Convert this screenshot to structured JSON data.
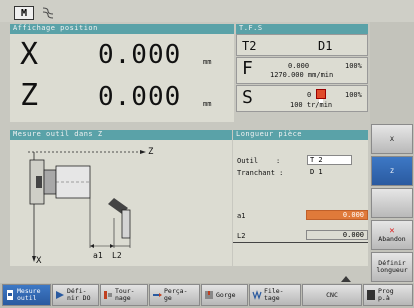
{
  "top_icons": [
    {
      "name": "m-icon",
      "label": "M"
    },
    {
      "name": "spiral-icon",
      "label": ""
    }
  ],
  "position": {
    "title": "Affichage position",
    "x_axis": "X",
    "x_value": "0.000",
    "z_axis": "Z",
    "z_value": "0.000",
    "unit": "mm"
  },
  "tfs": {
    "title": "T.F.S",
    "t_label": "T2",
    "d_label": "D1",
    "f_letter": "F",
    "f_value": "0.000",
    "f_percent": "100%",
    "f_feed": "1270.000 mm/min",
    "s_letter": "S",
    "s_value": "0",
    "s_percent": "100%",
    "s_speed": "100 tr/min"
  },
  "measure": {
    "title": "Mesure outil dans Z",
    "axis_z": "Z",
    "axis_x": "X",
    "dim_a1": "a1",
    "dim_l2": "L2"
  },
  "length": {
    "title": "Longueur pièce",
    "outil_label": "Outil",
    "outil_colon": ":",
    "outil_value": "T 2",
    "tranchant_label": "Tranchant :",
    "tranchant_value": "D 1",
    "a1_label": "a1",
    "a1_value": "0.000",
    "l2_label": "L2",
    "l2_value": "0.000"
  },
  "right_softkeys": {
    "x_label": "X",
    "z_label": "Z",
    "abandon_label": "Abandon",
    "definir_line1": "Définir",
    "definir_line2": "longueur"
  },
  "bottom_softkeys": {
    "mesure_line1": "Mesure",
    "mesure_line2": "outil",
    "defi_line1": "Défi-",
    "defi_line2": "nir DO",
    "tour_line1": "Tour-",
    "tour_line2": "nage",
    "perca_line1": "Perça-",
    "perca_line2": "ge",
    "gorge_label": "Gorge",
    "file_line1": "File-",
    "file_line2": "tage",
    "cnc_label": "CNC",
    "prog_line1": "Prog",
    "prog_line2": "p.à"
  },
  "colors": {
    "title_bar": "#5aa2a8",
    "panel": "#dcdcd2",
    "active_blue": "#2a5aa0",
    "a1_highlight": "#e07a3a",
    "s_box": "#e04a2a"
  }
}
